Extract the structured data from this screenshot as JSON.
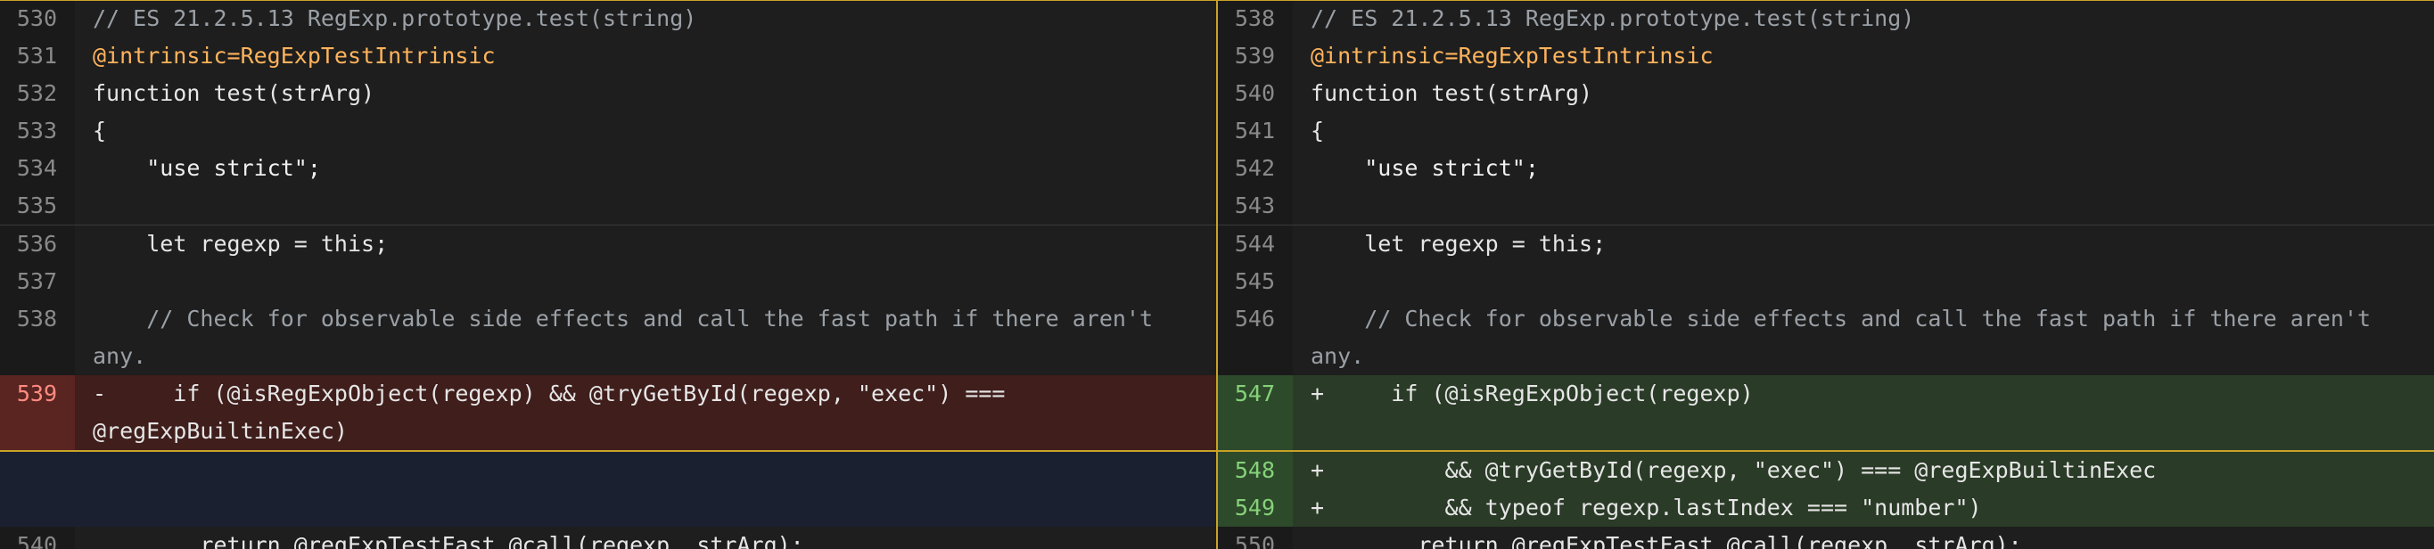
{
  "left": {
    "lines": [
      {
        "num": "530",
        "text": "// ES 21.2.5.13 RegExp.prototype.test(string)"
      },
      {
        "num": "531",
        "text": "@intrinsic=RegExpTestIntrinsic"
      },
      {
        "num": "532",
        "text": "function test(strArg)"
      },
      {
        "num": "533",
        "text": "{"
      },
      {
        "num": "534",
        "text": "    \"use strict\";"
      },
      {
        "num": "535",
        "text": ""
      },
      {
        "num": "536",
        "text": "    let regexp = this;"
      },
      {
        "num": "537",
        "text": ""
      },
      {
        "num": "538",
        "text": "    // Check for observable side effects and call the fast path if there aren't any."
      },
      {
        "num": "539",
        "text": "-     if (@isRegExpObject(regexp) && @tryGetById(regexp, \"exec\") === @regExpBuiltinExec)"
      },
      {
        "num": "540",
        "text": "        return @regExpTestFast.@call(regexp, strArg);"
      }
    ]
  },
  "right": {
    "lines": [
      {
        "num": "538",
        "text": "// ES 21.2.5.13 RegExp.prototype.test(string)"
      },
      {
        "num": "539",
        "text": "@intrinsic=RegExpTestIntrinsic"
      },
      {
        "num": "540",
        "text": "function test(strArg)"
      },
      {
        "num": "541",
        "text": "{"
      },
      {
        "num": "542",
        "text": "    \"use strict\";"
      },
      {
        "num": "543",
        "text": ""
      },
      {
        "num": "544",
        "text": "    let regexp = this;"
      },
      {
        "num": "545",
        "text": ""
      },
      {
        "num": "546",
        "text": "    // Check for observable side effects and call the fast path if there aren't any."
      },
      {
        "num": "547",
        "text": "+     if (@isRegExpObject(regexp)"
      },
      {
        "num": "548",
        "text": "+         && @tryGetById(regexp, \"exec\") === @regExpBuiltinExec"
      },
      {
        "num": "549",
        "text": "+         && typeof regexp.lastIndex === \"number\")"
      },
      {
        "num": "550",
        "text": "        return @regExpTestFast.@call(regexp, strArg);"
      }
    ]
  },
  "colors": {
    "removed_bg": "#3f1e1c",
    "added_bg": "#2a3b27",
    "highlight_border": "#c9a227"
  }
}
